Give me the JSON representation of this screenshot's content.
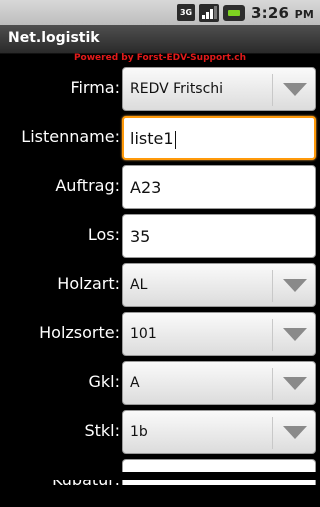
{
  "statusbar": {
    "network_type": "3G",
    "time": "3:26",
    "time_suffix": "PM",
    "icons": [
      "3g-icon",
      "signal-icon",
      "battery-icon"
    ]
  },
  "app": {
    "title": "Net.logistik",
    "powered_by": "Powered by Forst-EDV-Support.ch"
  },
  "form": {
    "firma": {
      "label": "Firma:",
      "value": "REDV Fritschi"
    },
    "listenname": {
      "label": "Listenname:",
      "value": "liste1"
    },
    "auftrag": {
      "label": "Auftrag:",
      "value": "A23"
    },
    "los": {
      "label": "Los:",
      "value": "35"
    },
    "holzart": {
      "label": "Holzart:",
      "value": "AL"
    },
    "holzsorte": {
      "label": "Holzsorte:",
      "value": "101"
    },
    "gkl": {
      "label": "Gkl:",
      "value": "A"
    },
    "stkl": {
      "label": "Stkl:",
      "value": "1b"
    },
    "kubatur": {
      "label": "Kubatur:",
      "value": ""
    }
  },
  "colors": {
    "focus_border": "#ff9a0a",
    "powered_text": "#e21a1a",
    "battery_fill": "#7ed321"
  }
}
